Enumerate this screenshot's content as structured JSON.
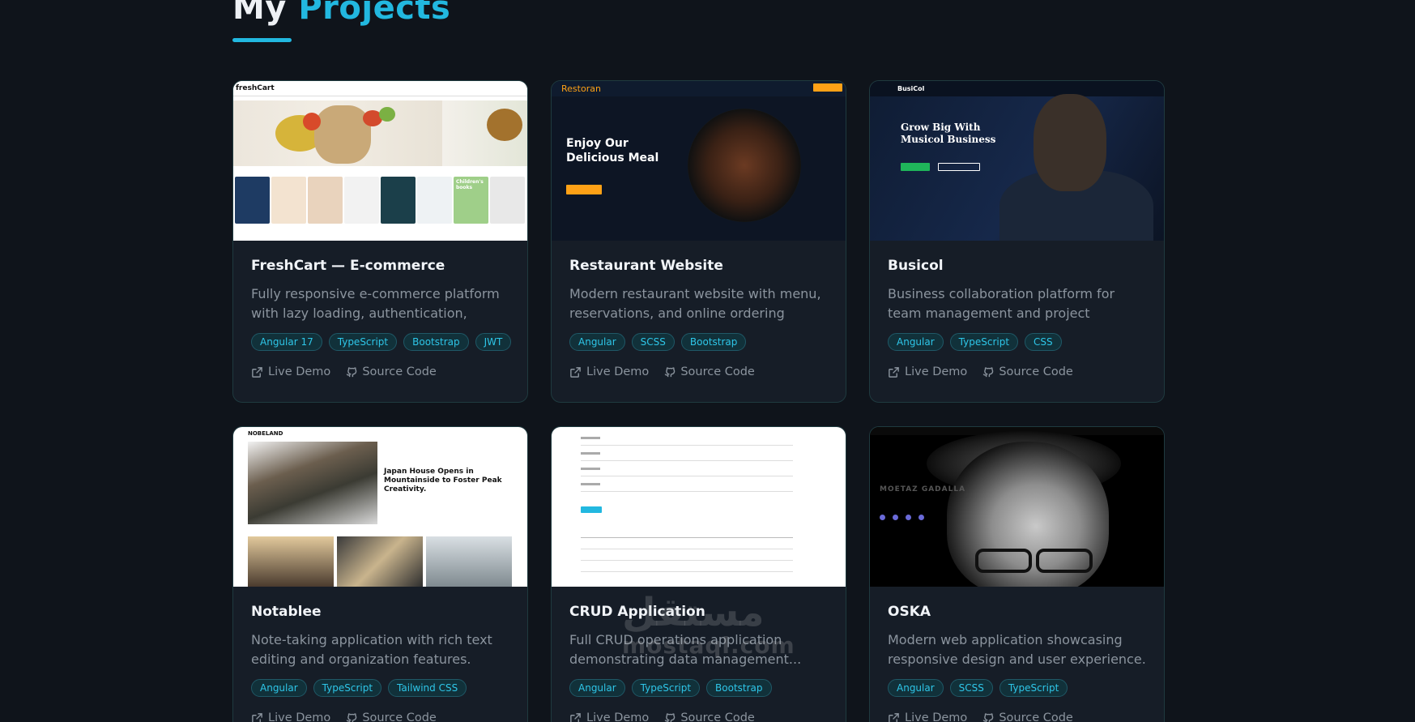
{
  "section": {
    "title_word1": "My",
    "title_word2": "Projects"
  },
  "colors": {
    "background": "#0f141b",
    "accent": "#22b8e0",
    "card": "#161d27",
    "tag_text": "#2ec6e8"
  },
  "link_labels": {
    "demo": "Live Demo",
    "code": "Source Code",
    "demo_icon": "external-link-icon",
    "code_icon": "github-icon"
  },
  "projects": [
    {
      "title": "FreshCart — E-commerce",
      "description": "Fully responsive e-commerce platform with lazy loading, authentication, email...",
      "tags": [
        "Angular 17",
        "TypeScript",
        "Bootstrap",
        "JWT"
      ],
      "thumb_text": "freshCart",
      "thumb_extra": "Children's books"
    },
    {
      "title": "Restaurant Website",
      "description": "Modern restaurant website with menu, reservations, and online ordering system.",
      "tags": [
        "Angular",
        "SCSS",
        "Bootstrap"
      ],
      "thumb_text": "Restoran",
      "thumb_headline_1": "Enjoy Our",
      "thumb_headline_2": "Delicious Meal"
    },
    {
      "title": "Busicol",
      "description": "Business collaboration platform for team management and project tracking.",
      "tags": [
        "Angular",
        "TypeScript",
        "CSS"
      ],
      "thumb_text": "BusiCol",
      "thumb_headline_1": "Grow Big With",
      "thumb_headline_2": "Musicol Business"
    },
    {
      "title": "Notablee",
      "description": "Note-taking application with rich text editing and organization features.",
      "tags": [
        "Angular",
        "TypeScript",
        "Tailwind CSS"
      ],
      "thumb_text": "NOBELAND",
      "thumb_headline": "Japan House Opens in Mountainside to Foster Peak Creativity."
    },
    {
      "title": "CRUD Application",
      "description": "Full CRUD operations application demonstrating data management...",
      "tags": [
        "Angular",
        "TypeScript",
        "Bootstrap"
      ]
    },
    {
      "title": "OSKA",
      "description": "Modern web application showcasing responsive design and user experience.",
      "tags": [
        "Angular",
        "SCSS",
        "TypeScript"
      ],
      "thumb_text": "MOETAZ GADALLA"
    }
  ],
  "watermark": {
    "arabic": "مستقل",
    "latin": "mostaql.com"
  }
}
